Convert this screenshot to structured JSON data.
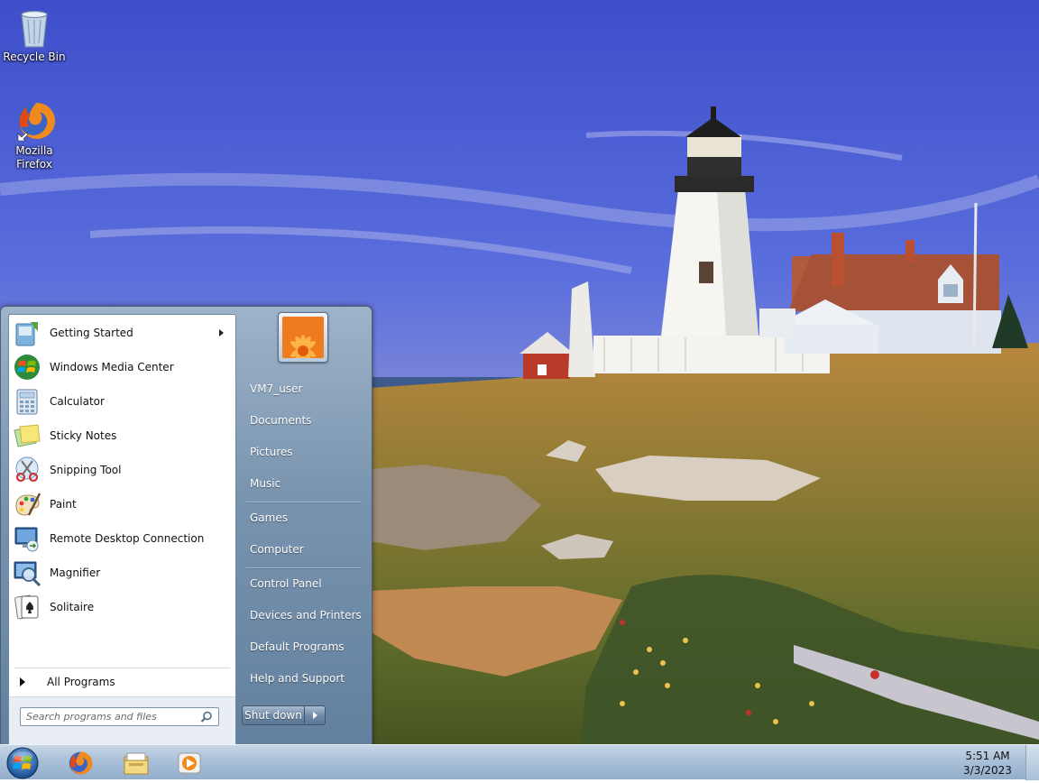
{
  "desktop": {
    "icons": [
      {
        "label": "Recycle Bin",
        "icon": "recycle-bin-icon"
      },
      {
        "label": "Mozilla Firefox",
        "icon": "firefox-icon"
      }
    ]
  },
  "start_menu": {
    "programs": [
      {
        "label": "Getting Started",
        "icon": "getting-started-icon",
        "has_submenu": true
      },
      {
        "label": "Windows Media Center",
        "icon": "media-center-icon"
      },
      {
        "label": "Calculator",
        "icon": "calculator-icon"
      },
      {
        "label": "Sticky Notes",
        "icon": "sticky-notes-icon"
      },
      {
        "label": "Snipping Tool",
        "icon": "snipping-tool-icon"
      },
      {
        "label": "Paint",
        "icon": "paint-icon"
      },
      {
        "label": "Remote Desktop Connection",
        "icon": "remote-desktop-icon"
      },
      {
        "label": "Magnifier",
        "icon": "magnifier-icon"
      },
      {
        "label": "Solitaire",
        "icon": "solitaire-icon"
      }
    ],
    "all_programs": "All Programs",
    "search_placeholder": "Search programs and files",
    "right": {
      "user": "VM7_user",
      "documents": "Documents",
      "pictures": "Pictures",
      "music": "Music",
      "games": "Games",
      "computer": "Computer",
      "control_panel": "Control Panel",
      "devices": "Devices and Printers",
      "default_programs": "Default Programs",
      "help": "Help and Support"
    },
    "shutdown": "Shut down"
  },
  "taskbar": {
    "pinned": [
      "firefox-icon",
      "windows-explorer-icon",
      "media-player-icon"
    ],
    "clock": {
      "time": "5:51 AM",
      "date": "3/3/2023"
    }
  }
}
